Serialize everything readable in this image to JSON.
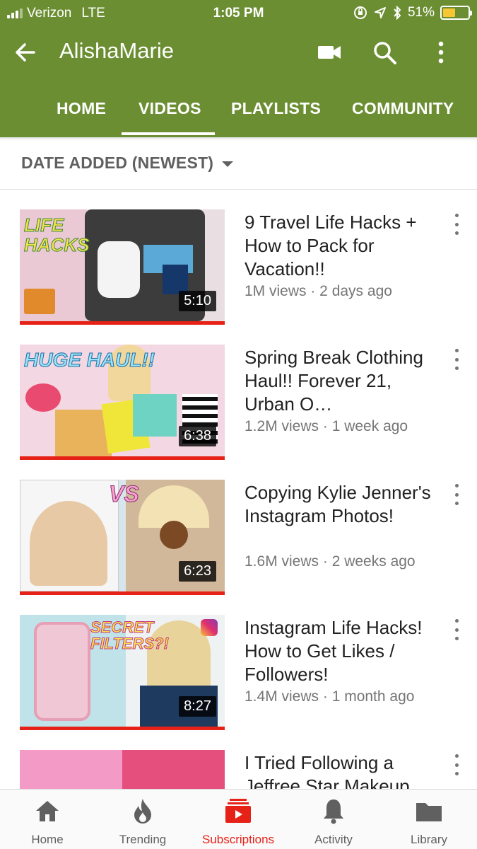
{
  "status_bar": {
    "carrier": "Verizon",
    "network": "LTE",
    "time": "1:05 PM",
    "battery": "51%",
    "battery_level": 0.51
  },
  "header": {
    "title": "AlishaMarie",
    "icons": [
      "back-arrow-icon",
      "video-camera-icon",
      "search-icon",
      "more-vert-icon"
    ]
  },
  "tabs": [
    {
      "label": "HOME",
      "active": false
    },
    {
      "label": "VIDEOS",
      "active": true
    },
    {
      "label": "PLAYLISTS",
      "active": false
    },
    {
      "label": "COMMUNITY",
      "active": false
    }
  ],
  "sort": {
    "label": "DATE ADDED (NEWEST)"
  },
  "videos": [
    {
      "title": "9 Travel Life Hacks + How to Pack for Vacation!!",
      "meta": "1M views · 2 days ago",
      "duration": "5:10",
      "thumb_text": "LIFE HACKS"
    },
    {
      "title": "Spring Break Clothing Haul!! Forever 21, Urban O…",
      "meta": "1.2M views · 1 week ago",
      "duration": "6:38",
      "thumb_text": "HUGE HAUL!!"
    },
    {
      "title": "Copying Kylie Jenner's Instagram Photos!",
      "meta": "1.6M views · 2 weeks ago",
      "duration": "6:23",
      "thumb_text": "VS"
    },
    {
      "title": "Instagram Life Hacks! How to Get Likes / Followers!",
      "meta": "1.4M views · 1 month ago",
      "duration": "8:27",
      "thumb_text": "SECRET FILTERS?!"
    },
    {
      "title": "I Tried Following a Jeffree Star Makeup",
      "meta": "",
      "duration": "",
      "thumb_text": ""
    }
  ],
  "bottom_nav": [
    {
      "label": "Home",
      "icon": "home-icon",
      "active": false
    },
    {
      "label": "Trending",
      "icon": "flame-icon",
      "active": false
    },
    {
      "label": "Subscriptions",
      "icon": "subscriptions-icon",
      "active": true
    },
    {
      "label": "Activity",
      "icon": "bell-icon",
      "active": false
    },
    {
      "label": "Library",
      "icon": "folder-icon",
      "active": false
    }
  ],
  "colors": {
    "header_green": "#6c8e32",
    "accent_red": "#e62117",
    "battery_yellow": "#f7c733"
  }
}
